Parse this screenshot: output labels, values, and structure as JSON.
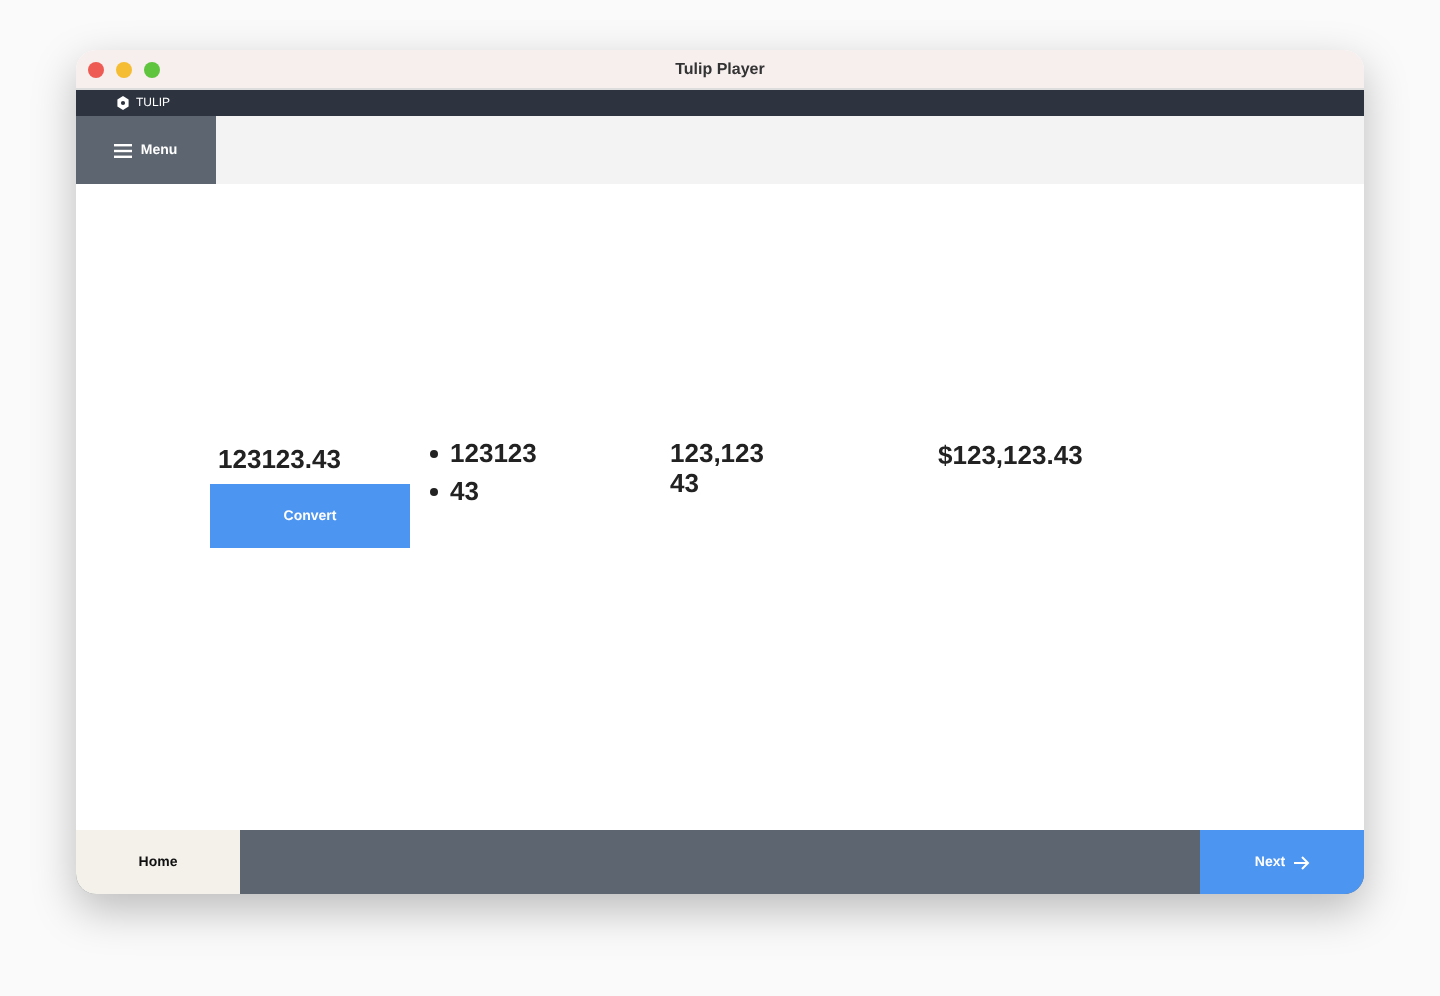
{
  "window": {
    "title": "Tulip Player"
  },
  "brand": "TULIP",
  "menu_button": "Menu",
  "converter": {
    "input_value": "123123.43",
    "button": "Convert"
  },
  "split_list": [
    "123123",
    "43"
  ],
  "formatted_lines": [
    "123,123",
    "43"
  ],
  "currency": "$123,123.43",
  "footer": {
    "home": "Home",
    "next": "Next"
  }
}
